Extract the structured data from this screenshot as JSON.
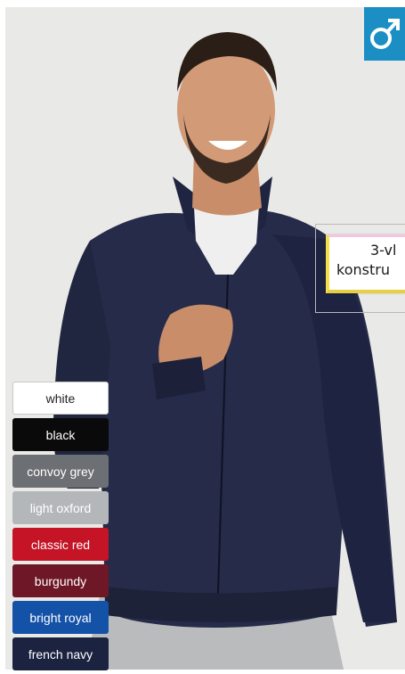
{
  "callout": {
    "line1": "3-vl",
    "line2": "konstru"
  },
  "gender_icon": "male-symbol-icon",
  "colours": [
    {
      "label": "white",
      "bg": "#ffffff",
      "fg": "#222222"
    },
    {
      "label": "black",
      "bg": "#0a0a0a",
      "fg": "#ffffff"
    },
    {
      "label": "convoy grey",
      "bg": "#6c6f73",
      "fg": "#ffffff"
    },
    {
      "label": "light oxford",
      "bg": "#b4b7ba",
      "fg": "#ffffff"
    },
    {
      "label": "classic red",
      "bg": "#c41426",
      "fg": "#ffffff"
    },
    {
      "label": "burgundy",
      "bg": "#6e1726",
      "fg": "#ffffff"
    },
    {
      "label": "bright royal",
      "bg": "#1452a7",
      "fg": "#ffffff"
    },
    {
      "label": "french navy",
      "bg": "#1b2341",
      "fg": "#ffffff"
    }
  ]
}
